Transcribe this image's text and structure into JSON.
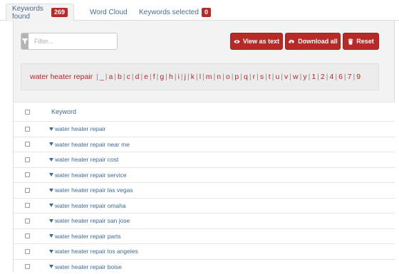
{
  "tabs": [
    {
      "label": "Keywords found",
      "badge": "269"
    },
    {
      "label": "Word Cloud"
    },
    {
      "label": "Keywords selected",
      "badge": "0"
    }
  ],
  "filter": {
    "placeholder": "Filter..."
  },
  "buttons": {
    "view_as_text": "View as text",
    "download_all": "Download all",
    "reset": "Reset"
  },
  "alphabet": {
    "keyword": "water heater repair",
    "letters": [
      "_",
      "a",
      "b",
      "c",
      "d",
      "e",
      "f",
      "g",
      "h",
      "i",
      "j",
      "k",
      "l",
      "m",
      "n",
      "o",
      "p",
      "q",
      "r",
      "s",
      "t",
      "u",
      "v",
      "w",
      "y",
      "1",
      "2",
      "4",
      "6",
      "7",
      "9"
    ]
  },
  "table": {
    "header": "Keyword",
    "rows": [
      "water heater repair",
      "water heater repair near me",
      "water heater repair cost",
      "water heater repair service",
      "water heater repair las vegas",
      "water heater repair omaha",
      "water heater repair san jose",
      "water heater repair parts",
      "water heater repair los angeles",
      "water heater repair boise"
    ]
  },
  "colors": {
    "accent": "#b72a27",
    "link": "#3e6a95"
  },
  "icons": {
    "filter": "funnel-icon",
    "view": "eye-icon",
    "download": "cloud-download-icon",
    "reset": "trash-icon"
  }
}
